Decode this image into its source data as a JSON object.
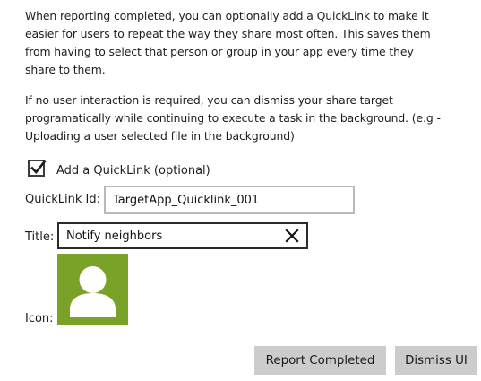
{
  "instructions": {
    "p1_lines": [
      "When reporting completed, you can optionally add a QuickLink to make it",
      "easier for users to repeat the way they share most often. This saves them",
      "from having to select that person or group in your app every time they",
      "share to them."
    ],
    "p2_lines": [
      "If no user interaction is required, you can dismiss your share target",
      "programatically while continuing to execute a task in the background. (e.g -",
      "Uploading a user selected file in the background)"
    ]
  },
  "quicklink": {
    "checkbox_label": "Add a QuickLink (optional)",
    "checked": true,
    "id_label": "QuickLink Id:",
    "id_value": "TargetApp_Quicklink_001",
    "title_label": "Title:",
    "title_value": "Notify neighbors",
    "icon_label": "Icon:",
    "icon": "person-icon",
    "icon_tile_color": "#7aa128"
  },
  "actions": {
    "report_label": "Report Completed",
    "dismiss_label": "Dismiss UI"
  }
}
